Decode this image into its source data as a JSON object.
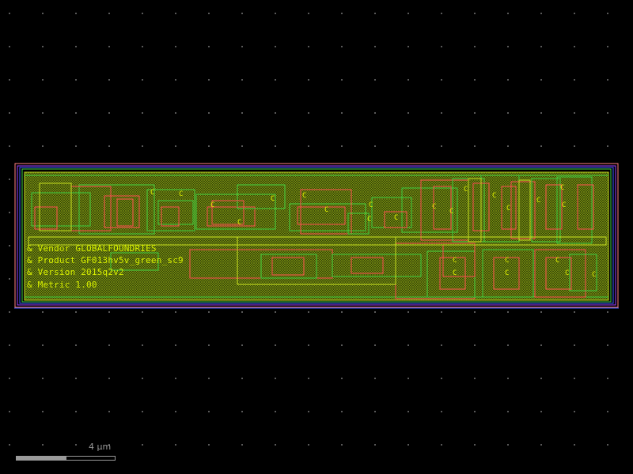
{
  "viewer": {
    "background": "#000000",
    "grid_color": "#6a6a6a"
  },
  "cell_labels": {
    "vendor": "& Vendor GLOBALFOUNDRIES",
    "product": "& Product GF013hv5v_green_sc9",
    "version": "& Version 2015q2v2",
    "metric": "& Metric 1.00"
  },
  "scale": {
    "label": "4 µm"
  },
  "layer_colors": {
    "boundary": "#ff8080",
    "nwell": "#a040ff",
    "comp": "#40d040",
    "poly": "#ff5050",
    "metal1": "#c8e020",
    "text": "#d8f000"
  },
  "pin_letters": [
    "C",
    "C",
    "C",
    "C",
    "C",
    "C",
    "C",
    "C",
    "C",
    "C",
    "C",
    "C",
    "C",
    "C",
    "C",
    "C",
    "C",
    "C",
    "C",
    "C",
    "C",
    "C",
    "C",
    "C",
    "C"
  ]
}
